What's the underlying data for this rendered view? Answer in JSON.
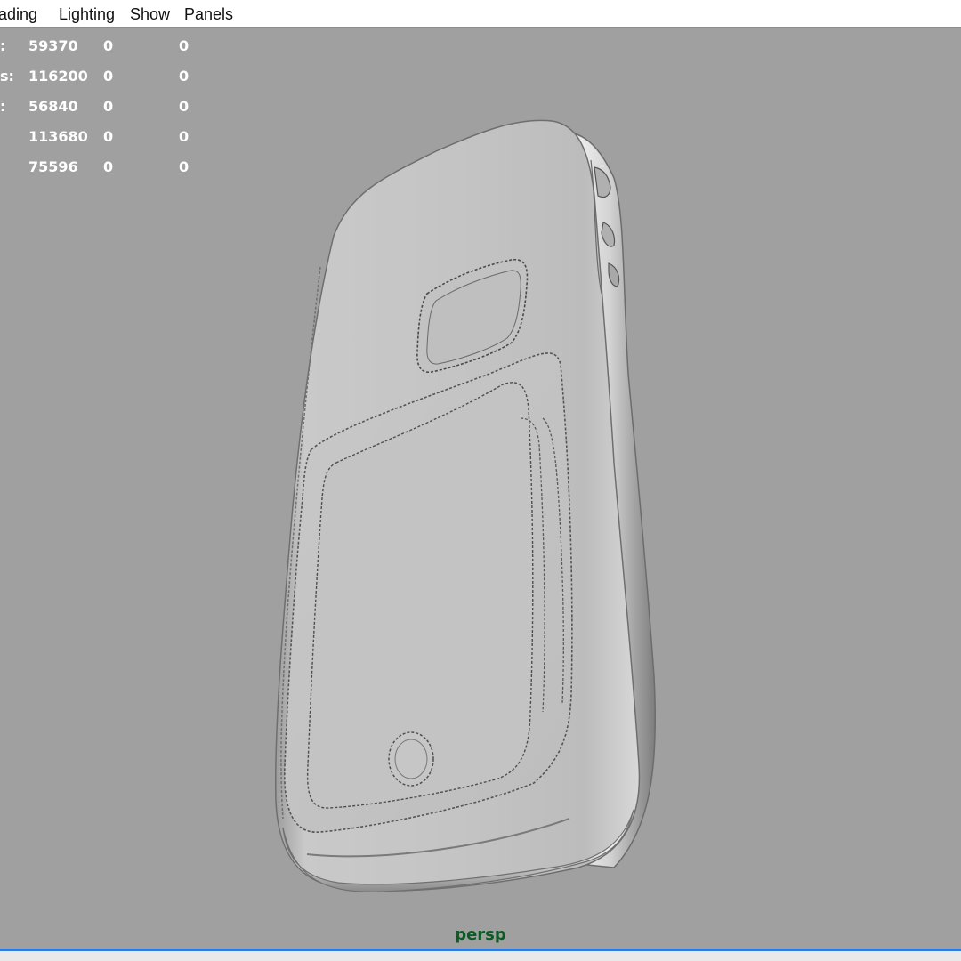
{
  "menubar": {
    "items": [
      "ading",
      "Lighting",
      "Show",
      "Panels"
    ]
  },
  "hud": {
    "rows": [
      {
        "label": ":",
        "v1": "59370",
        "v2": "0",
        "v3": "0"
      },
      {
        "label": "s:",
        "v1": "116200",
        "v2": "0",
        "v3": "0"
      },
      {
        "label": ":",
        "v1": "56840",
        "v2": "0",
        "v3": "0"
      },
      {
        "label": "",
        "v1": "113680",
        "v2": "0",
        "v3": "0"
      },
      {
        "label": "",
        "v1": "75596",
        "v2": "0",
        "v3": "0"
      }
    ]
  },
  "viewport": {
    "camera_label": "persp",
    "background_color": "#a0a0a0",
    "model": "phone-back-3d-model"
  },
  "colors": {
    "camera_label": "#0d5a25",
    "hud_text": "#ffffff",
    "bottom_accent": "#2f7bd9"
  }
}
